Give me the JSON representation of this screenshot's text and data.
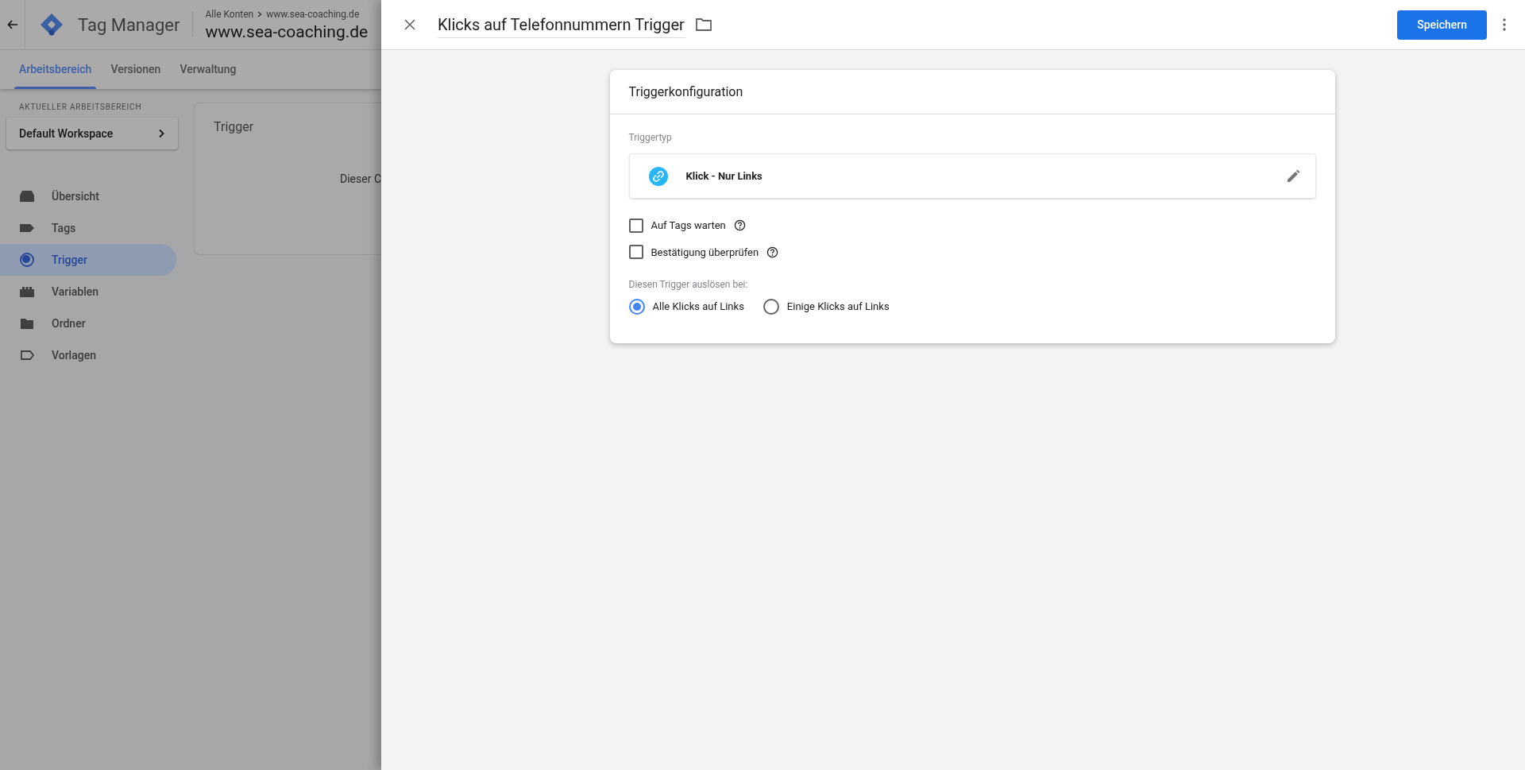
{
  "app": {
    "title": "Tag Manager",
    "breadcrumb": {
      "root": "Alle Konten",
      "current": "www.sea-coaching.de"
    },
    "container": "www.sea-coaching.de"
  },
  "tabs": [
    {
      "label": "Arbeitsbereich",
      "selected": true
    },
    {
      "label": "Versionen",
      "selected": false
    },
    {
      "label": "Verwaltung",
      "selected": false
    }
  ],
  "workspace": {
    "label": "AKTUELLER ARBEITSBEREICH",
    "name": "Default Workspace"
  },
  "nav": [
    {
      "label": "Übersicht",
      "kind": "overview",
      "selected": false
    },
    {
      "label": "Tags",
      "kind": "tag",
      "selected": false
    },
    {
      "label": "Trigger",
      "kind": "trigger",
      "selected": true
    },
    {
      "label": "Variablen",
      "kind": "variable",
      "selected": false
    },
    {
      "label": "Ordner",
      "kind": "folder",
      "selected": false
    },
    {
      "label": "Vorlagen",
      "kind": "template",
      "selected": false
    }
  ],
  "background_card": {
    "title": "Trigger",
    "text": "Dieser C"
  },
  "editor": {
    "name": "Klicks auf Telefonnummern Trigger",
    "save": "Speichern",
    "config": {
      "title": "Triggerkonfiguration",
      "type_label": "Triggertyp",
      "type": "Klick - Nur Links",
      "options": [
        {
          "label": "Auf Tags warten",
          "checked": false
        },
        {
          "label": "Bestätigung überprüfen",
          "checked": false
        }
      ],
      "fire_label": "Diesen Trigger auslösen bei:",
      "fire_options": [
        {
          "label": "Alle Klicks auf Links",
          "selected": true
        },
        {
          "label": "Einige Klicks auf Links",
          "selected": false
        }
      ]
    }
  }
}
